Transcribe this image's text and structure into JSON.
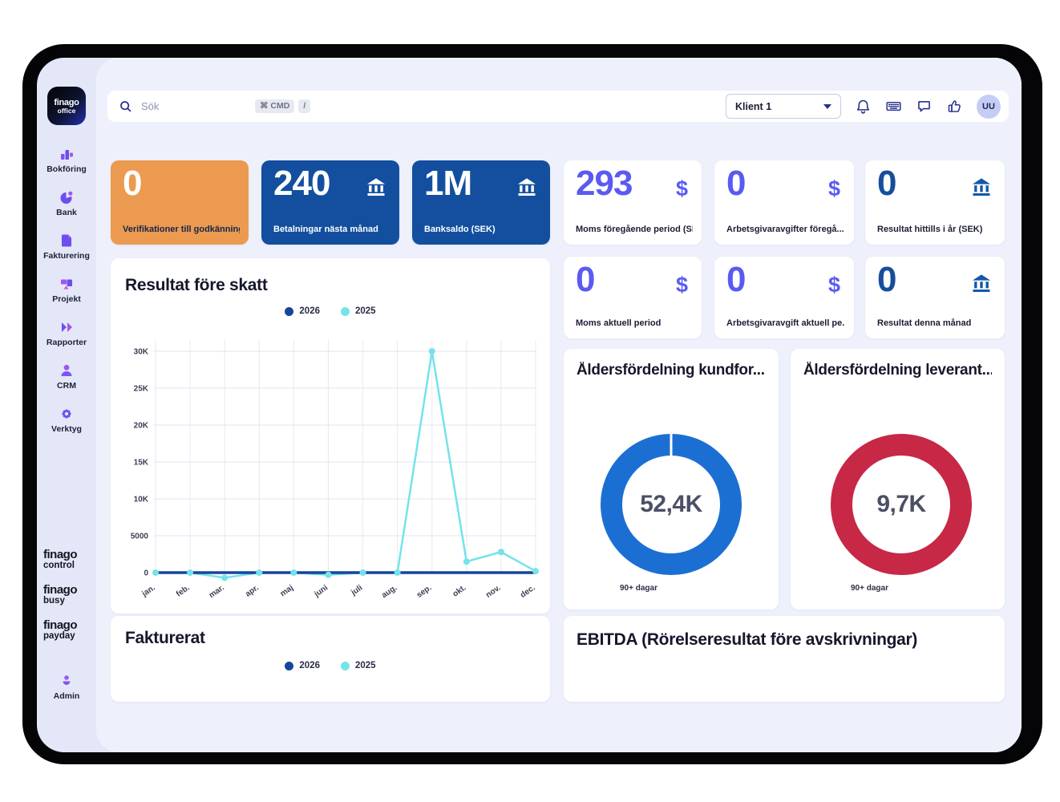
{
  "colors": {
    "accent_purple": "#5a5af2",
    "accent_navy": "#174e9b",
    "card_blue": "#134f9e",
    "card_orange": "#eb9a4f",
    "series_navy": "#16459c",
    "series_cyan": "#74e3ea",
    "donut_blue": "#1c6fd2",
    "donut_red": "#c62845"
  },
  "topbar": {
    "search_placeholder": "Sök",
    "shortcut_cmd": "⌘ CMD",
    "shortcut_slash": "/",
    "client_selector": "Klient 1",
    "avatar_initials": "UU"
  },
  "sidebar": {
    "logo_line1": "finago",
    "logo_line2": "office",
    "items": [
      {
        "label": "Bokföring"
      },
      {
        "label": "Bank"
      },
      {
        "label": "Fakturering"
      },
      {
        "label": "Projekt"
      },
      {
        "label": "Rapporter"
      },
      {
        "label": "CRM"
      },
      {
        "label": "Verktyg"
      }
    ],
    "brands": [
      {
        "name": "finago",
        "product": "control"
      },
      {
        "name": "finago",
        "product": "busy"
      },
      {
        "name": "finago",
        "product": "payday"
      }
    ],
    "admin_label": "Admin"
  },
  "kpis": {
    "left": [
      {
        "value": "0",
        "label": "Verifikationer till godkänning"
      },
      {
        "value": "240",
        "label": "Betalningar nästa månad"
      },
      {
        "value": "1M",
        "label": "Banksaldo (SEK)"
      }
    ],
    "right_row1": [
      {
        "value": "293",
        "label": "Moms föregående period (SEK)"
      },
      {
        "value": "0",
        "label": "Arbetsgivaravgifter föregå..."
      },
      {
        "value": "0",
        "label": "Resultat hittills i år (SEK)"
      }
    ],
    "right_row2": [
      {
        "value": "0",
        "label": "Moms aktuell period"
      },
      {
        "value": "0",
        "label": "Arbetsgivaravgift aktuell pe..."
      },
      {
        "value": "0",
        "label": "Resultat denna månad"
      }
    ]
  },
  "icons": {
    "dollar": "$"
  },
  "chart_data": [
    {
      "id": "resultat-fore-skatt",
      "type": "line",
      "title": "Resultat före skatt",
      "categories": [
        "jan.",
        "feb.",
        "mar.",
        "apr.",
        "maj",
        "juni",
        "juli",
        "aug.",
        "sep.",
        "okt.",
        "nov.",
        "dec."
      ],
      "series": [
        {
          "name": "2026",
          "color": "#16459c",
          "width": 3.5,
          "markers": false,
          "values": [
            0,
            0,
            0,
            0,
            0,
            0,
            0,
            0,
            0,
            0,
            0,
            0
          ]
        },
        {
          "name": "2025",
          "color": "#74e3ea",
          "width": 2.5,
          "markers": true,
          "values": [
            0,
            0,
            -700,
            0,
            0,
            -300,
            0,
            0,
            30000,
            1500,
            2800,
            200
          ]
        }
      ],
      "ylim": [
        -1500,
        30000
      ],
      "yticks": [
        0,
        5000,
        10000,
        15000,
        20000,
        25000,
        30000
      ],
      "ytick_labels": [
        "0",
        "5000",
        "10K",
        "15K",
        "20K",
        "25K",
        "30K"
      ],
      "grid": true,
      "legend_position": "top-center"
    },
    {
      "id": "aldersfordelning-kundfordringar",
      "type": "pie",
      "title": "Åldersfördelning kundfor...",
      "center_value": "52,4K",
      "slices": [
        {
          "label": "90+ dagar",
          "value": 52400,
          "color": "#1c6fd2"
        }
      ],
      "gap_at_top": true
    },
    {
      "id": "aldersfordelning-leverantorsskulder",
      "type": "pie",
      "title": "Åldersfördelning leverant...",
      "center_value": "9,7K",
      "slices": [
        {
          "label": "90+ dagar",
          "value": 9700,
          "color": "#c62845"
        }
      ],
      "gap_at_top": false
    },
    {
      "id": "fakturerat",
      "type": "line",
      "title": "Fakturerat",
      "series": [
        {
          "name": "2026",
          "color": "#16459c"
        },
        {
          "name": "2025",
          "color": "#74e3ea"
        }
      ],
      "legend_position": "top-center"
    },
    {
      "id": "ebitda",
      "type": "line",
      "title": "EBITDA (Rörelseresultat före avskrivningar)"
    }
  ]
}
